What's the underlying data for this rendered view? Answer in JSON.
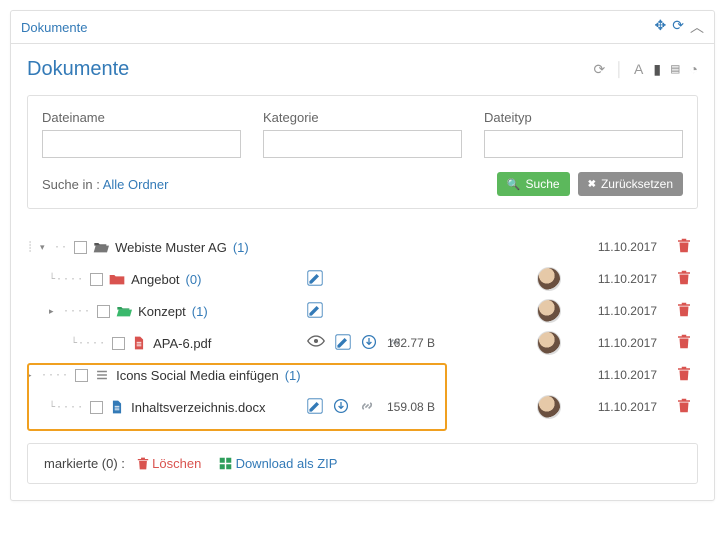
{
  "header": {
    "title": "Dokumente"
  },
  "main": {
    "heading": "Dokumente",
    "search": {
      "filename_label": "Dateiname",
      "category_label": "Kategorie",
      "filetype_label": "Dateityp",
      "search_in_prefix": "Suche in : ",
      "search_in_link": "Alle Ordner",
      "search_btn": "Suche",
      "reset_btn": "Zurücksetzen"
    },
    "tree": {
      "rows": [
        {
          "name": "Webiste Muster AG",
          "count": "(1)",
          "date": "11.10.2017"
        },
        {
          "name": "Angebot",
          "count": "(0)",
          "date": "11.10.2017"
        },
        {
          "name": "Konzept",
          "count": "(1)",
          "date": "11.10.2017"
        },
        {
          "name": "APA-6.pdf",
          "size": "162.77 B",
          "date": "11.10.2017"
        },
        {
          "name": "Icons Social Media einfügen",
          "count": "(1)",
          "date": "11.10.2017"
        },
        {
          "name": "Inhaltsverzeichnis.docx",
          "size": "159.08 B",
          "date": "11.10.2017"
        }
      ]
    },
    "footer": {
      "marked_prefix": "markierte (0) :",
      "delete": "Löschen",
      "download_zip": "Download als ZIP"
    }
  }
}
